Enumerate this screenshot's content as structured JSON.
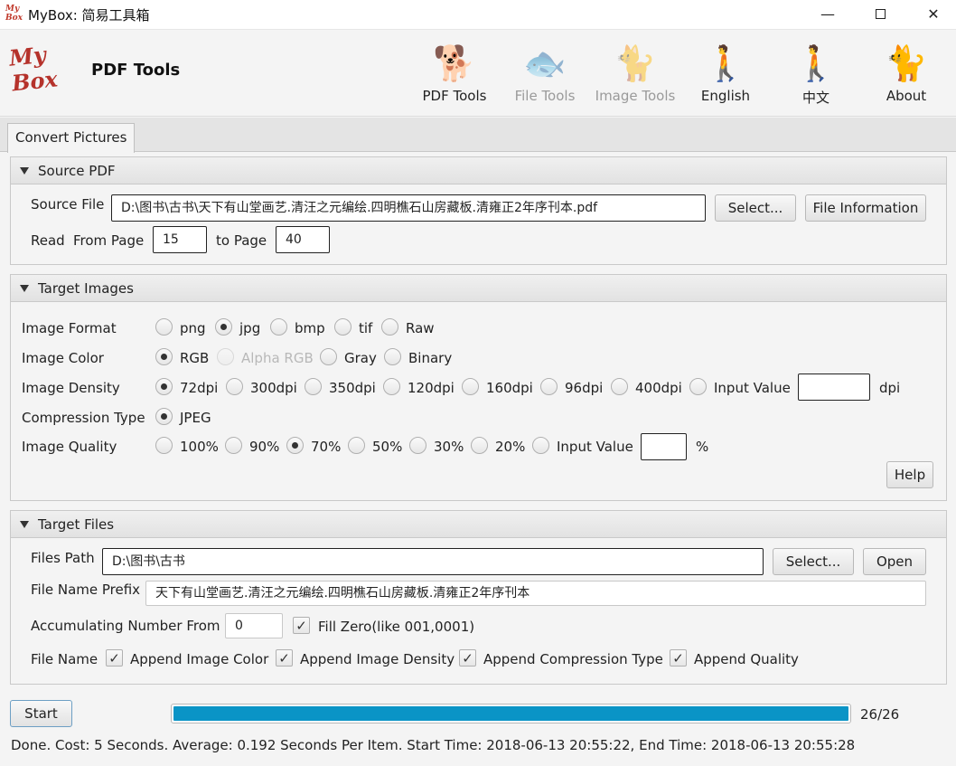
{
  "window": {
    "title": "MyBox:  简易工具箱",
    "icon_text": "My Box",
    "min": "—",
    "close": "✕"
  },
  "header": {
    "logo": "My Box",
    "page_title": "PDF Tools",
    "nav": [
      {
        "label": "PDF Tools",
        "icon": "red-dog-icon",
        "glyph": "🐕",
        "color": "#d9302c"
      },
      {
        "label": "File Tools",
        "icon": "fish-icon",
        "glyph": "🐟",
        "color": "#8a8fd6"
      },
      {
        "label": "Image Tools",
        "icon": "cat-icon",
        "glyph": "🐈",
        "color": "#e8a26a"
      },
      {
        "label": "English",
        "icon": "person-dog-icon",
        "glyph": "🚶",
        "color": "#3a3a9a"
      },
      {
        "label": "中文",
        "icon": "person-red-icon",
        "glyph": "🚶",
        "color": "#d9302c"
      },
      {
        "label": "About",
        "icon": "pink-cat-icon",
        "glyph": "🐈",
        "color": "#f29ac4"
      }
    ]
  },
  "tabs": {
    "active": "Convert Pictures"
  },
  "source_pdf": {
    "header": "Source PDF",
    "source_file_label": "Source File",
    "source_file_value": "D:\\图书\\古书\\天下有山堂画艺.清汪之元编绘.四明樵石山房藏板.清雍正2年序刊本.pdf",
    "select_button": "Select...",
    "file_info_button": "File Information",
    "read_label": "Read",
    "from_page_label": "From Page",
    "from_page_value": "15",
    "to_page_label": "to Page",
    "to_page_value": "40"
  },
  "target_images": {
    "header": "Target Images",
    "format_label": "Image Format",
    "formats": [
      "png",
      "jpg",
      "bmp",
      "tif",
      "Raw"
    ],
    "format_selected": "jpg",
    "color_label": "Image Color",
    "colors": [
      "RGB",
      "Alpha RGB",
      "Gray",
      "Binary"
    ],
    "color_selected": "RGB",
    "density_label": "Image Density",
    "densities": [
      "72dpi",
      "300dpi",
      "350dpi",
      "120dpi",
      "160dpi",
      "96dpi",
      "400dpi",
      "Input Value"
    ],
    "density_selected": "72dpi",
    "density_unit": "dpi",
    "density_input_value": "",
    "compression_label": "Compression Type",
    "compression_option": "JPEG",
    "quality_label": "Image Quality",
    "qualities": [
      "100%",
      "90%",
      "70%",
      "50%",
      "30%",
      "20%",
      "Input Value"
    ],
    "quality_selected": "70%",
    "quality_unit": "%",
    "quality_input_value": "",
    "help_button": "Help"
  },
  "target_files": {
    "header": "Target Files",
    "path_label": "Files Path",
    "path_value": "D:\\图书\\古书",
    "select_button": "Select...",
    "open_button": "Open",
    "prefix_label": "File Name Prefix",
    "prefix_value": "天下有山堂画艺.清汪之元编绘.四明樵石山房藏板.清雍正2年序刊本",
    "accum_label": "Accumulating Number From",
    "accum_value": "0",
    "fill_zero_label": "Fill Zero(like 001,0001)",
    "file_name_label": "File Name",
    "append_color": "Append Image Color",
    "append_density": "Append Image Density",
    "append_compression": "Append Compression Type",
    "append_quality": "Append Quality"
  },
  "footer": {
    "start_button": "Start",
    "progress": 1.0,
    "progress_text": "26/26",
    "status": "Done. Cost: 5 Seconds. Average: 0.192 Seconds Per Item. Start Time: 2018-06-13 20:55:22, End Time: 2018-06-13 20:55:28"
  }
}
